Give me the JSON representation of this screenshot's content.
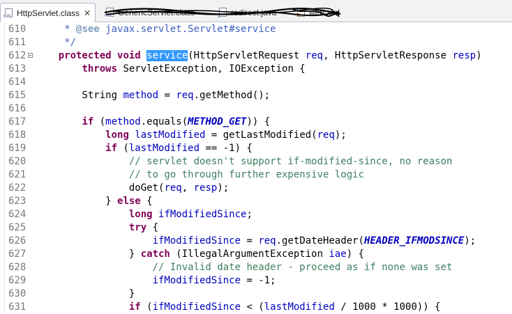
{
  "tabs": [
    {
      "label": "HttpServlet.class",
      "icon": "class-file-icon",
      "active": true,
      "close": "✕"
    },
    {
      "label": "GenericServlet.class",
      "icon": "class-file-icon",
      "active": false
    },
    {
      "label": "redirect.java",
      "icon": "java-file-icon",
      "active": false
    },
    {
      "label": "web.xml",
      "icon": "xml-file-icon",
      "active": false
    }
  ],
  "editor": {
    "lines": [
      {
        "n": "610",
        "html": "     <span class=\"jd\">* </span><span class=\"jdtag\">@see</span><span class=\"jd\"> javax.servlet.Servlet#service</span>"
      },
      {
        "n": "611",
        "html": "     <span class=\"jd\">*/</span>"
      },
      {
        "n": "612",
        "fold": true,
        "html": "    <span class=\"kw\">protected</span> <span class=\"kw\">void</span> <span class=\"hl\">service</span>(HttpServletRequest <span class=\"fld\">req</span>, HttpServletResponse <span class=\"fld\">resp</span>)"
      },
      {
        "n": "613",
        "html": "        <span class=\"kw\">throws</span> ServletException, IOException {"
      },
      {
        "n": "614",
        "html": ""
      },
      {
        "n": "615",
        "html": "        String <span class=\"fld\">method</span> = <span class=\"fld\">req</span>.getMethod();"
      },
      {
        "n": "616",
        "html": ""
      },
      {
        "n": "617",
        "html": "        <span class=\"kw\">if</span> (<span class=\"fld\">method</span>.equals(<span class=\"cst\">METHOD_GET</span>)) {"
      },
      {
        "n": "618",
        "html": "            <span class=\"kw\">long</span> <span class=\"fld\">lastModified</span> = getLastModified(<span class=\"fld\">req</span>);"
      },
      {
        "n": "619",
        "html": "            <span class=\"kw\">if</span> (<span class=\"fld\">lastModified</span> == -1) {"
      },
      {
        "n": "620",
        "html": "                <span class=\"cm\">// servlet doesn't support if-modified-since, no reason</span>"
      },
      {
        "n": "621",
        "html": "                <span class=\"cm\">// to go through further expensive logic</span>"
      },
      {
        "n": "622",
        "html": "                doGet(<span class=\"fld\">req</span>, <span class=\"fld\">resp</span>);"
      },
      {
        "n": "623",
        "html": "            } <span class=\"kw\">else</span> {"
      },
      {
        "n": "624",
        "html": "                <span class=\"kw\">long</span> <span class=\"fld\">ifModifiedSince</span>;"
      },
      {
        "n": "625",
        "html": "                <span class=\"kw\">try</span> {"
      },
      {
        "n": "626",
        "html": "                    <span class=\"fld\">ifModifiedSince</span> = <span class=\"fld\">req</span>.getDateHeader(<span class=\"cst\">HEADER_IFMODSINCE</span>);"
      },
      {
        "n": "627",
        "html": "                } <span class=\"kw\">catch</span> (IllegalArgumentException <span class=\"fld\">iae</span>) {"
      },
      {
        "n": "628",
        "html": "                    <span class=\"cm\">// Invalid date header - proceed as if none was set</span>"
      },
      {
        "n": "629",
        "html": "                    <span class=\"fld\">ifModifiedSince</span> = -1;"
      },
      {
        "n": "630",
        "html": "                }"
      },
      {
        "n": "631",
        "html": "                <span class=\"kw\">if</span> (<span class=\"fld\">ifModifiedSince</span> &lt; (<span class=\"fld\">lastModified</span> / 1000 * 1000)) {"
      }
    ]
  },
  "colors": {
    "keyword": "#7f0055",
    "comment": "#3f7f5f",
    "javadoc": "#3f5fbf",
    "field": "#0000c0",
    "selection": "#3399ff",
    "line_number": "#787878"
  }
}
